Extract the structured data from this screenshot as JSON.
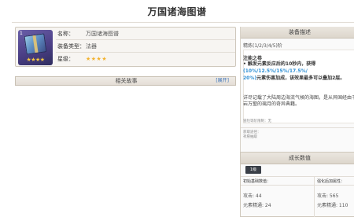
{
  "page_title": "万国诸海图谱",
  "equipment": {
    "icon_name": "book-catalyst-icon",
    "icon_level": "1",
    "icon_stars": "★★★★",
    "rows": [
      {
        "label": "名称：",
        "value": "万国诸海图谱"
      },
      {
        "label": "装备类型：",
        "value": "法器"
      },
      {
        "label": "星级：",
        "value": "★★★★"
      }
    ]
  },
  "story": {
    "title": "相关故事",
    "toggle": "[展开]"
  },
  "description": {
    "header": "装备描述",
    "refine": "精炼(1/2/3/4/5)阶",
    "skill_name": "注能之卷",
    "effect_prefix": "• 触发元素反应后的10秒内，获得",
    "effect_highlight_1": "(10%/12.5%/15%/17.5%/",
    "effect_highlight_2": "20%)",
    "effect_suffix": "元素伤害加成，该效果最多可以叠加2层。",
    "lore": "详尽记载了大陆周边海流气候的海图，是从异国经由千岩万壑的璃月的奇异典籍。",
    "meta1": "冒险等阶限制：无",
    "meta2_line1": "获取途径：",
    "meta2_line2": "祈愿抽取"
  },
  "growth": {
    "header": "成长数值",
    "level_tab": "1级",
    "col1": "初始基础数值：",
    "col2": "强化后加属性：",
    "attack_label": "攻击: 44",
    "em_label": "元素精通: 24",
    "attack_bonus": "攻击: 565",
    "em_bonus": "元素精通: 110"
  },
  "colors": {
    "accent_blue": "#2e8fd4",
    "star_gold": "#f2b22e",
    "header_bg": "#e4ded6"
  }
}
